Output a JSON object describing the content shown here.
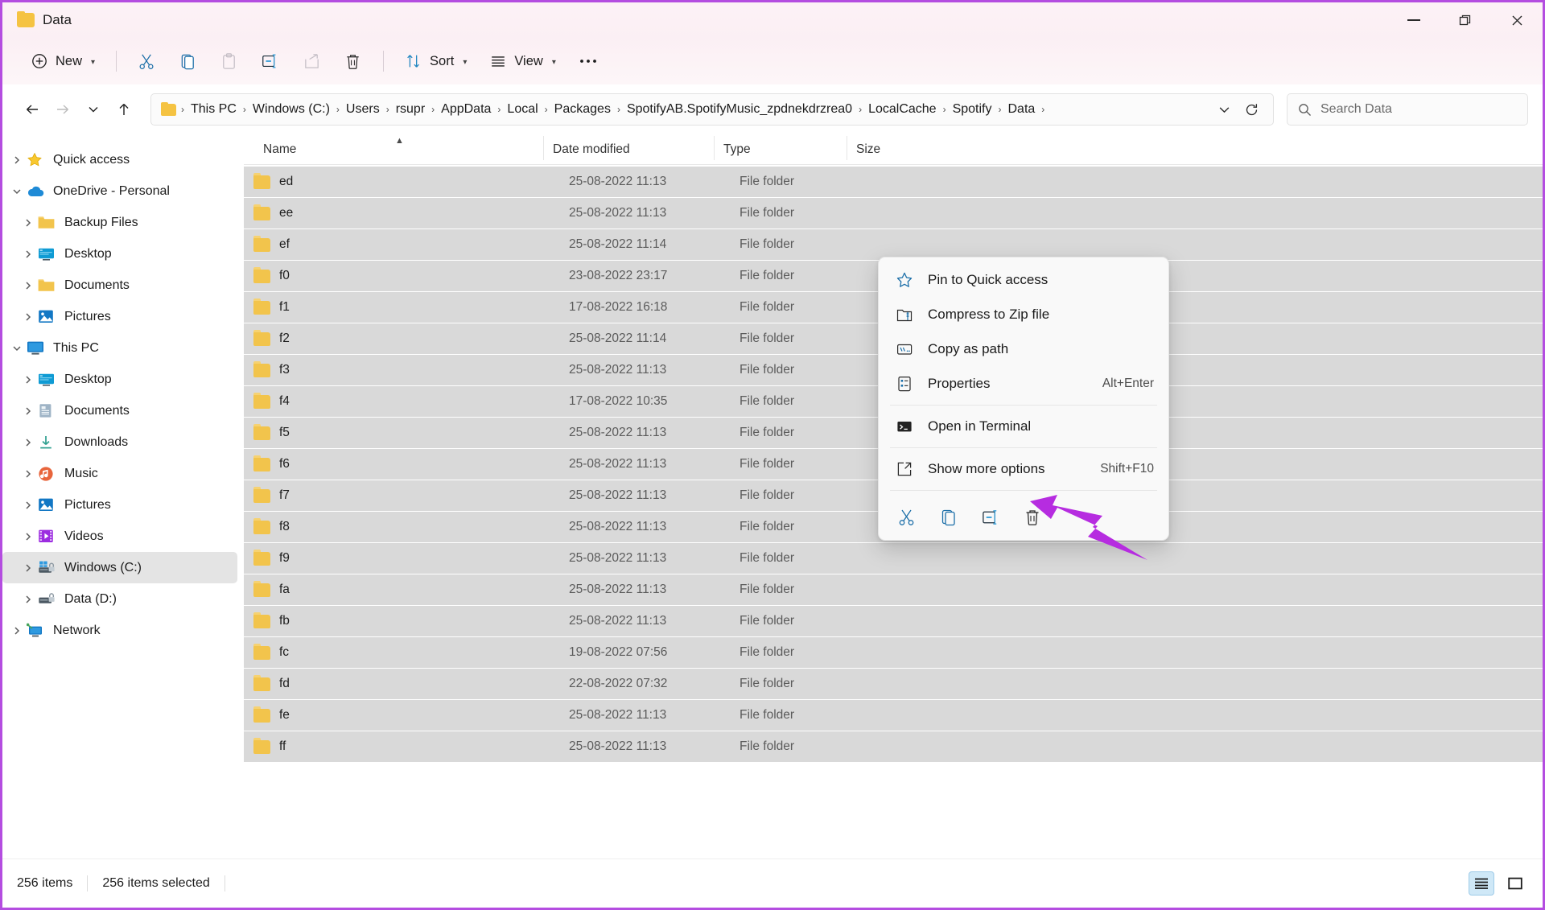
{
  "window": {
    "title": "Data",
    "title_icon": "folder-icon",
    "controls": {
      "minimize": "minimize-icon",
      "maximize": "maximize-icon",
      "close": "close-icon"
    }
  },
  "toolbar": {
    "new_label": "New",
    "sort_label": "Sort",
    "view_label": "View",
    "more_label": "···",
    "items": [
      {
        "name": "new-button",
        "label": "New",
        "icon": "plus-circle-icon",
        "has_chevron": true,
        "enabled": true
      },
      {
        "name": "cut-button",
        "label": "Cut",
        "icon": "scissors-icon",
        "enabled": true
      },
      {
        "name": "copy-button",
        "label": "Copy",
        "icon": "copy-icon",
        "enabled": true
      },
      {
        "name": "paste-button",
        "label": "Paste",
        "icon": "clipboard-icon",
        "enabled": false
      },
      {
        "name": "rename-button",
        "label": "Rename",
        "icon": "rename-icon",
        "enabled": true
      },
      {
        "name": "share-button",
        "label": "Share",
        "icon": "share-icon",
        "enabled": false
      },
      {
        "name": "delete-button",
        "label": "Delete",
        "icon": "trash-icon",
        "enabled": true
      },
      {
        "name": "sort-button",
        "label": "Sort",
        "icon": "sort-arrows-icon",
        "has_chevron": true,
        "enabled": true
      },
      {
        "name": "view-button",
        "label": "View",
        "icon": "view-lines-icon",
        "has_chevron": true,
        "enabled": true
      },
      {
        "name": "see-more-button",
        "label": "···",
        "icon": "ellipsis-icon",
        "enabled": true
      }
    ]
  },
  "address": {
    "back_icon": "arrow-left-icon",
    "forward_icon": "arrow-right-icon",
    "recent_icon": "chevron-down-icon",
    "up_icon": "arrow-up-icon",
    "folder_icon": "folder-icon",
    "breadcrumbs": [
      "This PC",
      "Windows (C:)",
      "Users",
      "rsupr",
      "AppData",
      "Local",
      "Packages",
      "SpotifyAB.SpotifyMusic_zpdnekdrzrea0",
      "LocalCache",
      "Spotify",
      "Data"
    ],
    "separator": "›",
    "dropdown_icon": "chevron-down-icon",
    "refresh_icon": "refresh-icon"
  },
  "search": {
    "icon": "search-icon",
    "placeholder": "Search Data"
  },
  "sidebar": {
    "items": [
      {
        "label": "Quick access",
        "icon": "star-icon",
        "level": 0,
        "expanded": false,
        "selected": false
      },
      {
        "label": "OneDrive - Personal",
        "icon": "cloud-icon",
        "level": 0,
        "expanded": true,
        "selected": false
      },
      {
        "label": "Backup Files",
        "icon": "folder-icon",
        "level": 1,
        "expanded": false,
        "selected": false
      },
      {
        "label": "Desktop",
        "icon": "desktop-icon",
        "level": 1,
        "expanded": false,
        "selected": false
      },
      {
        "label": "Documents",
        "icon": "folder-icon",
        "level": 1,
        "expanded": false,
        "selected": false
      },
      {
        "label": "Pictures",
        "icon": "pictures-icon",
        "level": 1,
        "expanded": false,
        "selected": false
      },
      {
        "label": "This PC",
        "icon": "pc-icon",
        "level": 0,
        "expanded": true,
        "selected": false
      },
      {
        "label": "Desktop",
        "icon": "desktop-icon",
        "level": 1,
        "expanded": false,
        "selected": false
      },
      {
        "label": "Documents",
        "icon": "documents-icon",
        "level": 1,
        "expanded": false,
        "selected": false
      },
      {
        "label": "Downloads",
        "icon": "download-icon",
        "level": 1,
        "expanded": false,
        "selected": false
      },
      {
        "label": "Music",
        "icon": "music-icon",
        "level": 1,
        "expanded": false,
        "selected": false
      },
      {
        "label": "Pictures",
        "icon": "pictures-icon",
        "level": 1,
        "expanded": false,
        "selected": false
      },
      {
        "label": "Videos",
        "icon": "videos-icon",
        "level": 1,
        "expanded": false,
        "selected": false
      },
      {
        "label": "Windows (C:)",
        "icon": "drive-windows-icon",
        "level": 1,
        "expanded": false,
        "selected": true
      },
      {
        "label": "Data (D:)",
        "icon": "drive-icon",
        "level": 1,
        "expanded": false,
        "selected": false
      },
      {
        "label": "Network",
        "icon": "network-icon",
        "level": 0,
        "expanded": false,
        "selected": false
      }
    ]
  },
  "filelist": {
    "columns": [
      "Name",
      "Date modified",
      "Type",
      "Size"
    ],
    "sort_column": "Name",
    "sort_direction": "ascending",
    "rows": [
      {
        "name": "ed",
        "date": "25-08-2022 11:13",
        "type": "File folder",
        "size": ""
      },
      {
        "name": "ee",
        "date": "25-08-2022 11:13",
        "type": "File folder",
        "size": ""
      },
      {
        "name": "ef",
        "date": "25-08-2022 11:14",
        "type": "File folder",
        "size": ""
      },
      {
        "name": "f0",
        "date": "23-08-2022 23:17",
        "type": "File folder",
        "size": ""
      },
      {
        "name": "f1",
        "date": "17-08-2022 16:18",
        "type": "File folder",
        "size": ""
      },
      {
        "name": "f2",
        "date": "25-08-2022 11:14",
        "type": "File folder",
        "size": ""
      },
      {
        "name": "f3",
        "date": "25-08-2022 11:13",
        "type": "File folder",
        "size": ""
      },
      {
        "name": "f4",
        "date": "17-08-2022 10:35",
        "type": "File folder",
        "size": ""
      },
      {
        "name": "f5",
        "date": "25-08-2022 11:13",
        "type": "File folder",
        "size": ""
      },
      {
        "name": "f6",
        "date": "25-08-2022 11:13",
        "type": "File folder",
        "size": ""
      },
      {
        "name": "f7",
        "date": "25-08-2022 11:13",
        "type": "File folder",
        "size": ""
      },
      {
        "name": "f8",
        "date": "25-08-2022 11:13",
        "type": "File folder",
        "size": ""
      },
      {
        "name": "f9",
        "date": "25-08-2022 11:13",
        "type": "File folder",
        "size": ""
      },
      {
        "name": "fa",
        "date": "25-08-2022 11:13",
        "type": "File folder",
        "size": ""
      },
      {
        "name": "fb",
        "date": "25-08-2022 11:13",
        "type": "File folder",
        "size": ""
      },
      {
        "name": "fc",
        "date": "19-08-2022 07:56",
        "type": "File folder",
        "size": ""
      },
      {
        "name": "fd",
        "date": "22-08-2022 07:32",
        "type": "File folder",
        "size": ""
      },
      {
        "name": "fe",
        "date": "25-08-2022 11:13",
        "type": "File folder",
        "size": ""
      },
      {
        "name": "ff",
        "date": "25-08-2022 11:13",
        "type": "File folder",
        "size": ""
      }
    ]
  },
  "context_menu": {
    "items": [
      {
        "label": "Pin to Quick access",
        "icon": "pin-star-icon",
        "accel": ""
      },
      {
        "label": "Compress to Zip file",
        "icon": "zip-folder-icon",
        "accel": ""
      },
      {
        "label": "Copy as path",
        "icon": "copy-path-icon",
        "accel": ""
      },
      {
        "label": "Properties",
        "icon": "properties-icon",
        "accel": "Alt+Enter"
      },
      {
        "label": "Open in Terminal",
        "icon": "terminal-icon",
        "accel": ""
      },
      {
        "label": "Show more options",
        "icon": "show-more-icon",
        "accel": "Shift+F10"
      }
    ],
    "action_bar": [
      {
        "name": "cut-button",
        "icon": "scissors-icon",
        "label": "Cut"
      },
      {
        "name": "copy-button",
        "icon": "copy-icon",
        "label": "Copy"
      },
      {
        "name": "rename-button",
        "icon": "rename-icon",
        "label": "Rename"
      },
      {
        "name": "delete-button",
        "icon": "trash-icon",
        "label": "Delete"
      }
    ]
  },
  "annotation": {
    "arrow_color": "#b62ce0",
    "points_to": "delete-button"
  },
  "status": {
    "item_count": "256 items",
    "selection": "256 items selected",
    "view_details_icon": "details-view-icon",
    "view_tiles_icon": "large-icons-view-icon",
    "active_view": "details"
  },
  "colors": {
    "window_border": "#b44de0",
    "folder_yellow": "#f2c44c",
    "row_background": "#d9d9d9",
    "accent_blue": "#0f6cbd",
    "arrow_purple": "#b62ce0"
  }
}
